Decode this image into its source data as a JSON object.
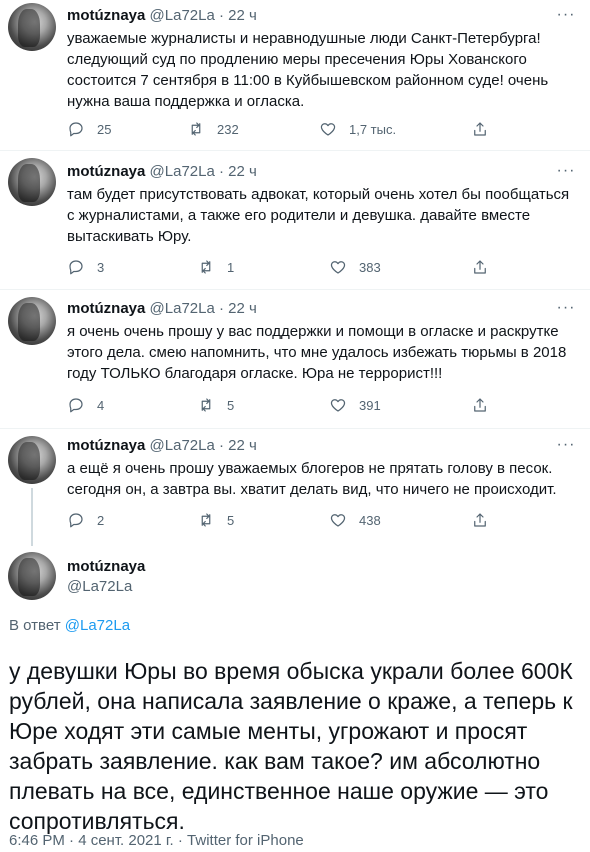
{
  "tweets": [
    {
      "name": "motúznaya",
      "handle": "@La72La",
      "time": "22 ч",
      "text": "уважаемые журналисты и неравнодушные люди Санкт-Петербурга! следующий суд по продлению меры пресечения Юры Хованского состоится 7 сентября в 11:00 в Куйбышевском районном суде! очень нужна ваша поддержка и огласка.",
      "replies": "25",
      "retweets": "232",
      "likes": "1,7 тыс."
    },
    {
      "name": "motúznaya",
      "handle": "@La72La",
      "time": "22 ч",
      "text": "там будет присутствовать адвокат, который очень хотел бы пообщаться с журналистами, а также его родители и девушка. давайте вместе вытаскивать Юру.",
      "replies": "3",
      "retweets": "1",
      "likes": "383"
    },
    {
      "name": "motúznaya",
      "handle": "@La72La",
      "time": "22 ч",
      "text": "я очень очень прошу у вас поддержки и помощи в огласке и раскрутке этого дела. смею напомнить, что мне удалось избежать тюрьмы в 2018 году ТОЛЬКО благодаря огласке. Юра не террорист!!!",
      "replies": "4",
      "retweets": "5",
      "likes": "391"
    },
    {
      "name": "motúznaya",
      "handle": "@La72La",
      "time": "22 ч",
      "text": "а ещё я очень прошу уважаемых блогеров не прятать голову в песок. сегодня он, а завтра вы. хватит делать вид, что ничего не происходит.",
      "replies": "2",
      "retweets": "5",
      "likes": "438"
    }
  ],
  "main": {
    "name": "motúznaya",
    "handle": "@La72La",
    "reply_prefix": "В ответ",
    "reply_handle": "@La72La",
    "text": "у девушки Юры во время обыска украли более 600К рублей, она написала заявление о краже, а теперь к Юре ходят эти самые менты, угрожают и просят забрать заявление. как вам такое? им абсолютно плевать на все, единственное наше оружие — это сопротивляться.",
    "meta": "6:46 PM · 4 сент. 2021 г. · Twitter for iPhone"
  },
  "icons": {
    "reply": "reply-icon",
    "retweet": "retweet-icon",
    "like": "heart-icon",
    "share": "share-icon",
    "more": "more-icon"
  },
  "colors": {
    "text": "#0f1419",
    "secondary": "#536471",
    "link": "#1d9bf0",
    "divider": "#eff3f4"
  }
}
